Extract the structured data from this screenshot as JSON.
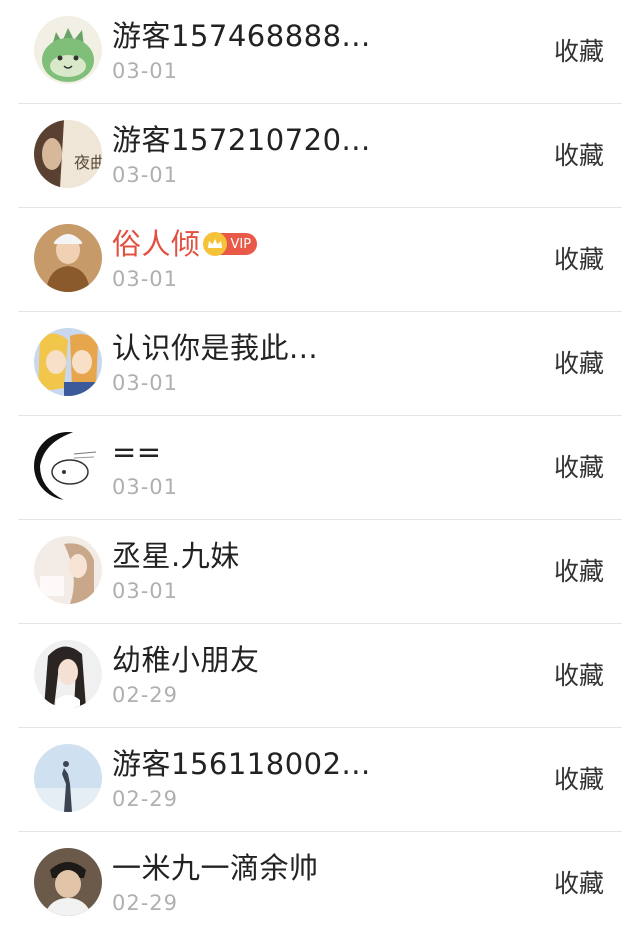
{
  "action_label": "收藏",
  "vip_text": "VIP",
  "entries": [
    {
      "name": "游客157468888...",
      "date": "03-01",
      "avatar": "dinosaur-avatar",
      "vip": false
    },
    {
      "name": "游客157210720...",
      "date": "03-01",
      "avatar": "portrait-avatar",
      "vip": false
    },
    {
      "name": "俗人倾",
      "date": "03-01",
      "avatar": "person-hat-avatar",
      "vip": true
    },
    {
      "name": "认识你是莪此...",
      "date": "03-01",
      "avatar": "anime-avatar",
      "vip": false
    },
    {
      "name": "==",
      "date": "03-01",
      "avatar": "sketch-avatar",
      "vip": false
    },
    {
      "name": "丞星.九妹",
      "date": "03-01",
      "avatar": "girl-light-avatar",
      "vip": false
    },
    {
      "name": "幼稚小朋友",
      "date": "02-29",
      "avatar": "girl-dark-hair-avatar",
      "vip": false
    },
    {
      "name": "游客156118002...",
      "date": "02-29",
      "avatar": "sky-avatar",
      "vip": false
    },
    {
      "name": "一米九一滴余帅",
      "date": "02-29",
      "avatar": "boy-avatar",
      "vip": false
    }
  ],
  "colors": {
    "vip_name": "#e2503f",
    "date": "#b0b0b0",
    "divider": "#e6e6e6"
  }
}
